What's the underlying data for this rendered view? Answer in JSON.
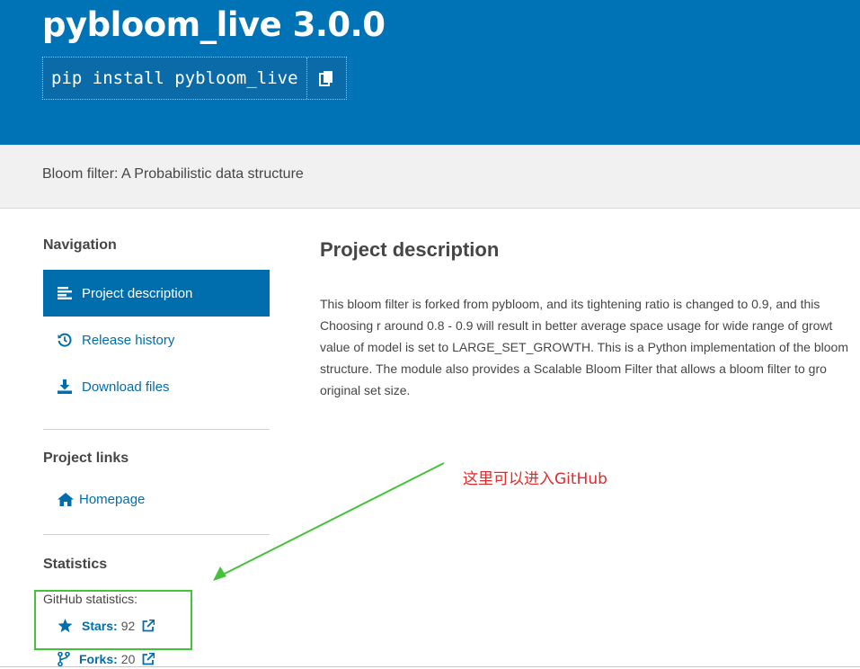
{
  "header": {
    "title": "pybloom_live 3.0.0",
    "pip_command": "pip install pybloom_live",
    "copy_icon": "copy-icon",
    "background_color": "#0073b7"
  },
  "summary": "Bloom filter: A Probabilistic data structure",
  "sidebar": {
    "navigation_heading": "Navigation",
    "nav_items": [
      {
        "label": "Project description",
        "icon": "align-left-icon",
        "active": true
      },
      {
        "label": "Release history",
        "icon": "history-icon",
        "active": false
      },
      {
        "label": "Download files",
        "icon": "download-icon",
        "active": false
      }
    ],
    "project_links_heading": "Project links",
    "project_links": [
      {
        "label": "Homepage",
        "icon": "home-icon"
      }
    ],
    "statistics_heading": "Statistics",
    "github_label": "GitHub statistics:",
    "stats": [
      {
        "label": "Stars:",
        "value": "92",
        "icon": "star-icon"
      },
      {
        "label": "Forks:",
        "value": "20",
        "icon": "fork-icon"
      }
    ]
  },
  "main": {
    "heading": "Project description",
    "description_lines": [
      "This bloom filter is forked from pybloom, and its tightening ratio is changed to 0.9, and this",
      "Choosing r around 0.8 - 0.9 will result in better average space usage for wide range of growt",
      "value of model is set to LARGE_SET_GROWTH. This is a Python implementation of the bloom",
      "structure. The module also provides a Scalable Bloom Filter that allows a bloom filter to gro",
      "original set size."
    ]
  },
  "annotation": {
    "text": "这里可以进入GitHub",
    "text_color": "#e12a2a",
    "box_color": "#44c23a"
  },
  "colors": {
    "link": "#006dad",
    "text": "#464646"
  }
}
